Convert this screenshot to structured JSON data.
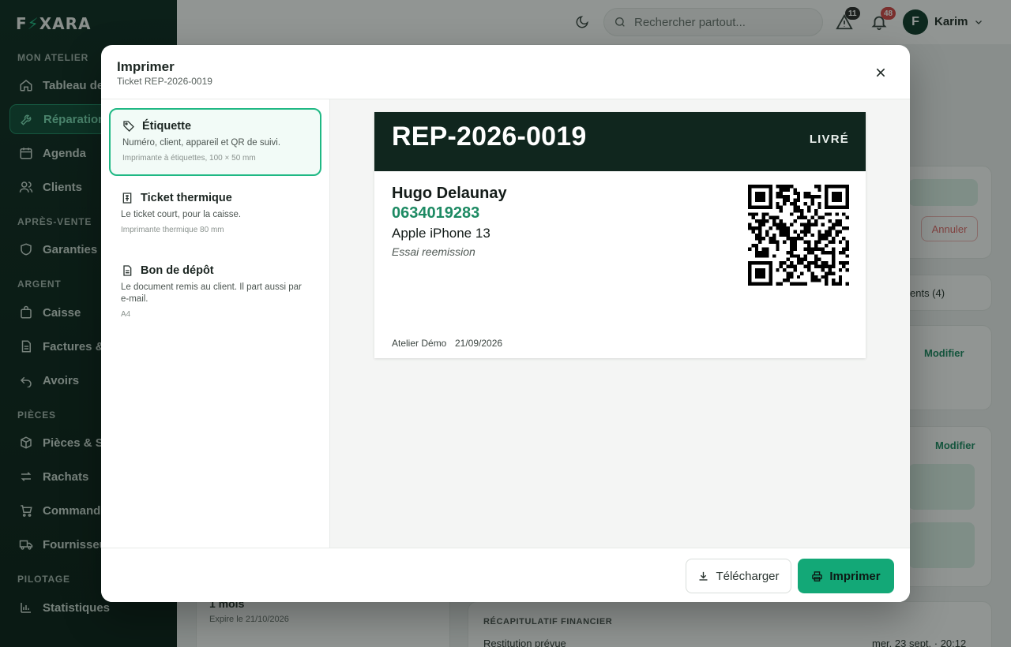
{
  "app": {
    "logo_left": "F",
    "logo_right": "XARA"
  },
  "sidebar": {
    "sections": [
      {
        "label": "MON ATELIER"
      },
      {
        "label": "APRÈS-VENTE"
      },
      {
        "label": "ARGENT"
      },
      {
        "label": "PIÈCES"
      },
      {
        "label": "PILOTAGE"
      }
    ],
    "items": [
      {
        "label": "Tableau de bord"
      },
      {
        "label": "Réparations"
      },
      {
        "label": "Agenda"
      },
      {
        "label": "Clients"
      },
      {
        "label": "Garanties"
      },
      {
        "label": "Caisse"
      },
      {
        "label": "Factures & devis"
      },
      {
        "label": "Avoirs"
      },
      {
        "label": "Pièces & Stock"
      },
      {
        "label": "Rachats"
      },
      {
        "label": "Commandes"
      },
      {
        "label": "Fournisseurs"
      },
      {
        "label": "Statistiques"
      }
    ]
  },
  "topbar": {
    "search_placeholder": "Rechercher partout...",
    "alerts_count": "11",
    "notifications_count": "48",
    "user_initial": "F",
    "user_name": "Karim"
  },
  "background": {
    "cancel_label": "Annuler",
    "tab_label": "ents (4)",
    "edit_label_1": "Modifier",
    "edit_label_2": "Modifier",
    "warranty_duration": "1 mois",
    "warranty_expiry": "Expire le 21/10/2026",
    "financial_title": "RÉCAPITULATIF FINANCIER",
    "restitution_label": "Restitution prévue",
    "restitution_value": "mer. 23 sept. · 20:12"
  },
  "modal": {
    "title": "Imprimer",
    "subtitle": "Ticket REP-2026-0019",
    "options": [
      {
        "title": "Étiquette",
        "desc": "Numéro, client, appareil et QR de suivi.",
        "meta": "Imprimante à étiquettes, 100 × 50 mm",
        "selected": true
      },
      {
        "title": "Ticket thermique",
        "desc": "Le ticket court, pour la caisse.",
        "meta": "Imprimante thermique 80 mm",
        "selected": false
      },
      {
        "title": "Bon de dépôt",
        "desc": "Le document remis au client. Il part aussi par e-mail.",
        "meta": "A4",
        "selected": false
      }
    ],
    "preview": {
      "reference": "REP-2026-0019",
      "status": "LIVRÉ",
      "customer_name": "Hugo Delaunay",
      "phone": "0634019283",
      "device": "Apple iPhone 13",
      "note": "Essai reemission",
      "shop": "Atelier Démo",
      "date": "21/09/2026"
    },
    "buttons": {
      "download": "Télécharger",
      "print": "Imprimer"
    }
  },
  "colors": {
    "accent": "#13a877",
    "brand_dark": "#10261e",
    "phone_green": "#1d8a63",
    "badge_dark": "#2b2b2b",
    "badge_red": "#d64545"
  }
}
